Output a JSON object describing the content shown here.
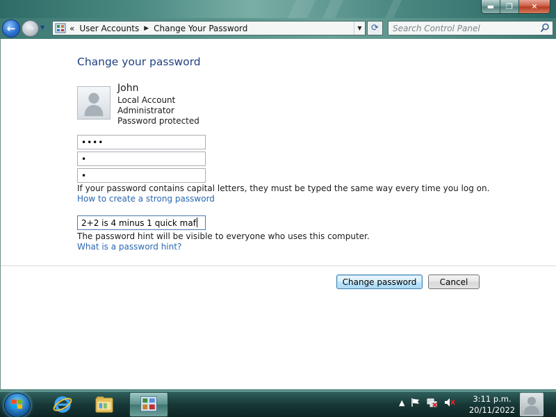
{
  "window": {
    "controls": {
      "minimize": "▬",
      "maximize": "❐",
      "close": "✕"
    }
  },
  "navbar": {
    "breadcrumb_chevron": "«",
    "breadcrumbs": [
      "User Accounts",
      "Change Your Password"
    ],
    "search_placeholder": "Search Control Panel"
  },
  "main": {
    "title": "Change your password",
    "user": {
      "name": "John",
      "account_type": "Local Account",
      "role": "Administrator",
      "status": "Password protected"
    },
    "fields": {
      "current_password": "••••",
      "new_password": "•",
      "confirm_password": "•",
      "password_hint": "2+2 is 4 minus 1 quick maf"
    },
    "capitals_note": "If your password contains capital letters, they must be typed the same way every time you log on.",
    "strong_password_link": "How to create a strong password",
    "hint_note": "The password hint will be visible to everyone who uses this computer.",
    "hint_link": "What is a password hint?",
    "change_button": "Change password",
    "cancel_button": "Cancel"
  },
  "taskbar": {
    "pinned": [
      "start-orb",
      "internet-explorer-icon",
      "windows-explorer-icon",
      "control-panel-icon"
    ],
    "clock_time": "3:11 p.m.",
    "clock_date": "20/11/2022"
  }
}
